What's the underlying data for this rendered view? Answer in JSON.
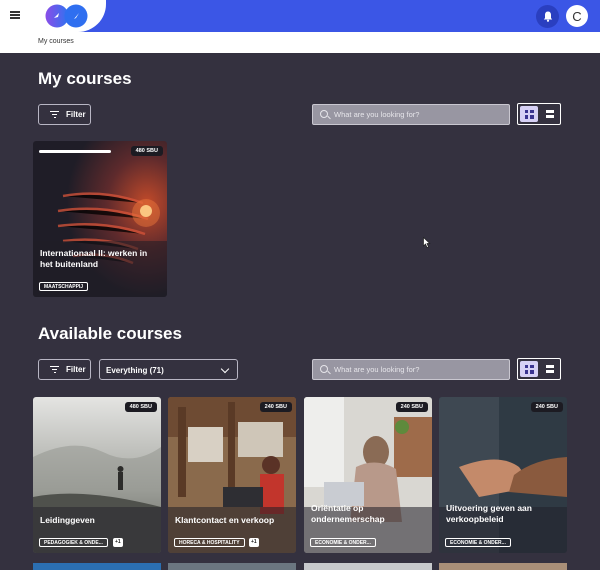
{
  "header": {
    "menu_icon": "hamburger-icon",
    "bell_icon": "bell-icon",
    "avatar_initial": "C",
    "accent": "#3b56e6"
  },
  "breadcrumb": {
    "label": "My courses"
  },
  "my_courses": {
    "title": "My courses",
    "filter_label": "Filter",
    "search_placeholder": "What are you looking for?",
    "cards": [
      {
        "sbu": "480 SBU",
        "title_line1": "Internationaal II: werken in",
        "title_line2": "het buitenland",
        "tag": "MAATSCHAPPIJ",
        "progress": 0.75
      }
    ]
  },
  "available_courses": {
    "title": "Available courses",
    "filter_label": "Filter",
    "select_value": "Everything (71)",
    "search_placeholder": "What are you looking for?",
    "cards": [
      {
        "sbu": "480 SBU",
        "title_line1": "Leidinggeven",
        "title_line2": "",
        "tag": "PEDAGOGIEK & ONDE...",
        "extra": "+1"
      },
      {
        "sbu": "240 SBU",
        "title_line1": "Klantcontact en verkoop",
        "title_line2": "",
        "tag": "HORECA & HOSPITALITY",
        "extra": "+1"
      },
      {
        "sbu": "240 SBU",
        "title_line1": "Oriëntatie op",
        "title_line2": "ondernemerschap",
        "tag": "ECONOMIE & ONDER...",
        "extra": ""
      },
      {
        "sbu": "240 SBU",
        "title_line1": "Uitvoering geven aan",
        "title_line2": "verkoopbeleid",
        "tag": "ECONOMIE & ONDER...",
        "extra": ""
      }
    ]
  }
}
